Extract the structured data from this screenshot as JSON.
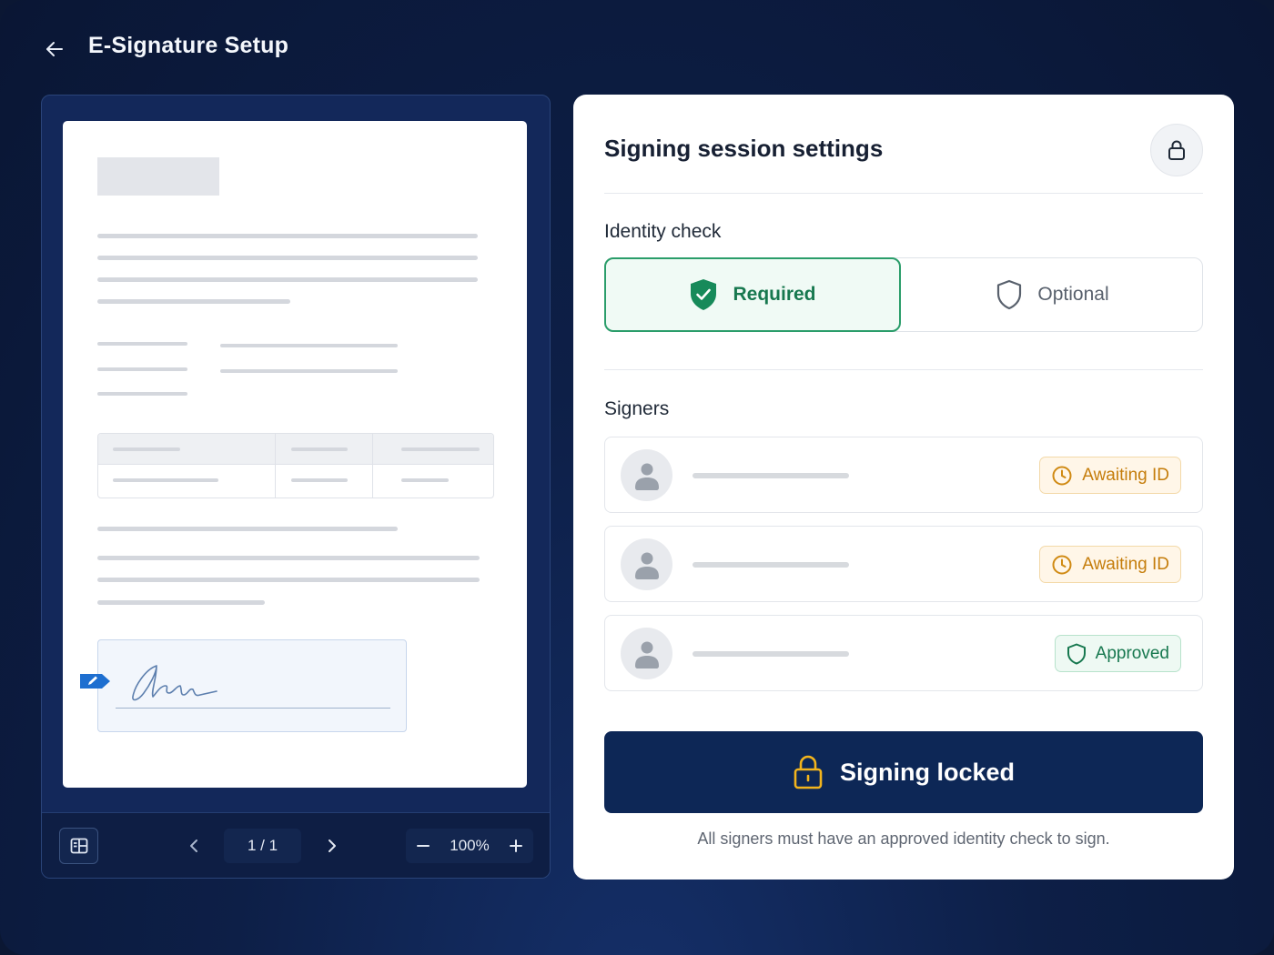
{
  "header": {
    "title": "E-Signature Setup",
    "back_icon": "arrow-left-icon"
  },
  "viewer": {
    "page_indicator": "1 / 1",
    "zoom": "100%",
    "icons": {
      "thumbnails": "thumbnails-icon",
      "prev": "chevron-left-icon",
      "next": "chevron-right-icon",
      "zoom_out": "minus-icon",
      "zoom_in": "plus-icon",
      "signature_tag": "pencil-icon"
    }
  },
  "settings": {
    "title": "Signing session settings",
    "lock_icon": "lock-icon",
    "identity_check": {
      "label": "Identity check",
      "options": [
        {
          "label": "Required",
          "selected": true,
          "icon": "shield-check-icon"
        },
        {
          "label": "Optional",
          "selected": false,
          "icon": "shield-icon"
        }
      ]
    },
    "signers": {
      "label": "Signers",
      "items": [
        {
          "status": "Awaiting ID",
          "status_type": "pending"
        },
        {
          "status": "Awaiting ID",
          "status_type": "pending"
        },
        {
          "status": "Approved",
          "status_type": "approved"
        }
      ]
    },
    "action": {
      "label": "Signing locked",
      "icon": "padlock-icon"
    },
    "helper_text": "All signers must have an approved identity check to sign."
  },
  "colors": {
    "background": "#0d1f47",
    "primary_button": "#0d2756",
    "success": "#17784f",
    "warning": "#c57d0b",
    "lock_accent": "#f2b41d"
  }
}
